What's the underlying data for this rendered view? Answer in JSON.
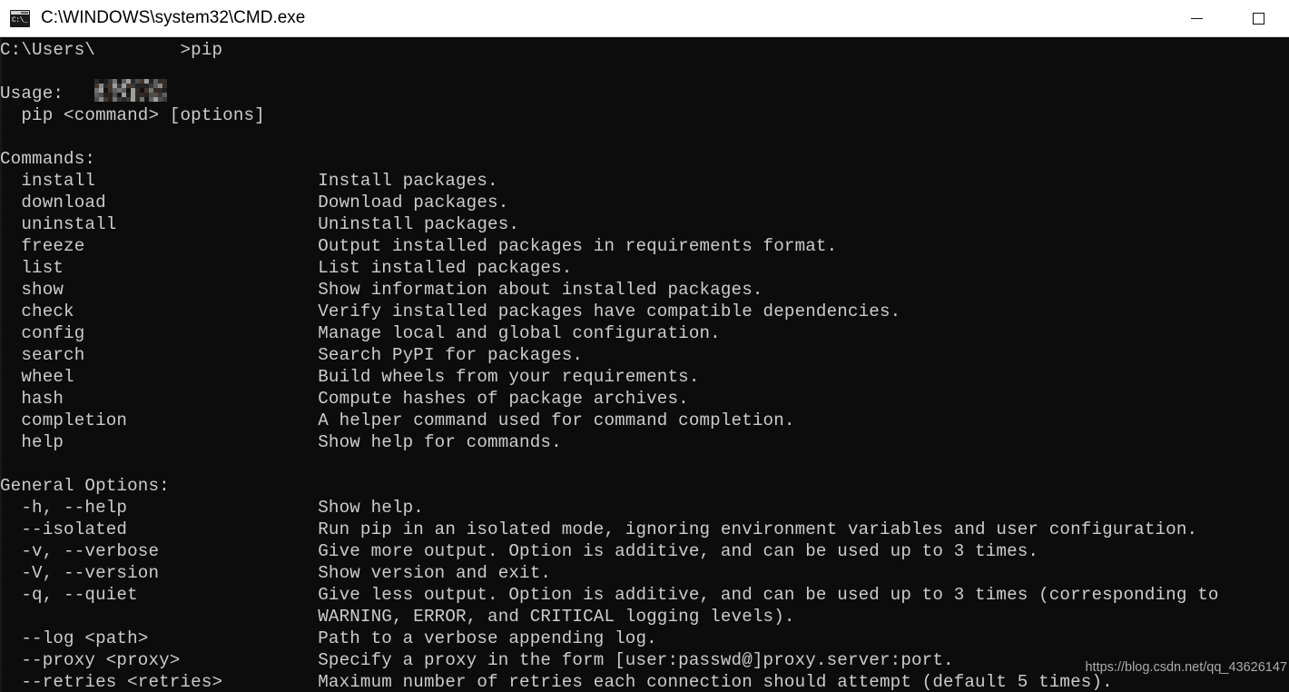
{
  "window": {
    "title": "C:\\WINDOWS\\system32\\CMD.exe",
    "icon_name": "cmd-icon",
    "icon_text": "C:\\_",
    "controls": {
      "minimize": "—",
      "maximize": "□"
    },
    "colors": {
      "titlebar_bg": "#ffffff",
      "titlebar_fg": "#000000",
      "console_bg": "#0c0c0c",
      "console_fg": "#cccccc"
    }
  },
  "console": {
    "prompt": {
      "prefix": "C:\\Users\\",
      "user_redacted": true,
      "suffix": ">",
      "command": "pip"
    },
    "output": "C:\\Users\\        >pip\n\nUsage:\n  pip <command> [options]\n\nCommands:\n  install                     Install packages.\n  download                    Download packages.\n  uninstall                   Uninstall packages.\n  freeze                      Output installed packages in requirements format.\n  list                        List installed packages.\n  show                        Show information about installed packages.\n  check                       Verify installed packages have compatible dependencies.\n  config                      Manage local and global configuration.\n  search                      Search PyPI for packages.\n  wheel                       Build wheels from your requirements.\n  hash                        Compute hashes of package archives.\n  completion                  A helper command used for command completion.\n  help                        Show help for commands.\n\nGeneral Options:\n  -h, --help                  Show help.\n  --isolated                  Run pip in an isolated mode, ignoring environment variables and user configuration.\n  -v, --verbose               Give more output. Option is additive, and can be used up to 3 times.\n  -V, --version               Show version and exit.\n  -q, --quiet                 Give less output. Option is additive, and can be used up to 3 times (corresponding to\n                              WARNING, ERROR, and CRITICAL logging levels).\n  --log <path>                Path to a verbose appending log.\n  --proxy <proxy>             Specify a proxy in the form [user:passwd@]proxy.server:port.\n  --retries <retries>         Maximum number of retries each connection should attempt (default 5 times).",
    "sections": {
      "usage_header": "Usage:",
      "usage_line": "pip <command> [options]",
      "commands_header": "Commands:",
      "general_options_header": "General Options:"
    },
    "commands": [
      {
        "name": "install",
        "desc": "Install packages."
      },
      {
        "name": "download",
        "desc": "Download packages."
      },
      {
        "name": "uninstall",
        "desc": "Uninstall packages."
      },
      {
        "name": "freeze",
        "desc": "Output installed packages in requirements format."
      },
      {
        "name": "list",
        "desc": "List installed packages."
      },
      {
        "name": "show",
        "desc": "Show information about installed packages."
      },
      {
        "name": "check",
        "desc": "Verify installed packages have compatible dependencies."
      },
      {
        "name": "config",
        "desc": "Manage local and global configuration."
      },
      {
        "name": "search",
        "desc": "Search PyPI for packages."
      },
      {
        "name": "wheel",
        "desc": "Build wheels from your requirements."
      },
      {
        "name": "hash",
        "desc": "Compute hashes of package archives."
      },
      {
        "name": "completion",
        "desc": "A helper command used for command completion."
      },
      {
        "name": "help",
        "desc": "Show help for commands."
      }
    ],
    "general_options": [
      {
        "name": "-h, --help",
        "desc": "Show help."
      },
      {
        "name": "--isolated",
        "desc": "Run pip in an isolated mode, ignoring environment variables and user configuration."
      },
      {
        "name": "-v, --verbose",
        "desc": "Give more output. Option is additive, and can be used up to 3 times."
      },
      {
        "name": "-V, --version",
        "desc": "Show version and exit."
      },
      {
        "name": "-q, --quiet",
        "desc": "Give less output. Option is additive, and can be used up to 3 times (corresponding to WARNING, ERROR, and CRITICAL logging levels)."
      },
      {
        "name": "--log <path>",
        "desc": "Path to a verbose appending log."
      },
      {
        "name": "--proxy <proxy>",
        "desc": "Specify a proxy in the form [user:passwd@]proxy.server:port."
      },
      {
        "name": "--retries <retries>",
        "desc": "Maximum number of retries each connection should attempt (default 5 times)."
      }
    ]
  },
  "watermark": {
    "text": "https://blog.csdn.net/qq_43626147"
  }
}
